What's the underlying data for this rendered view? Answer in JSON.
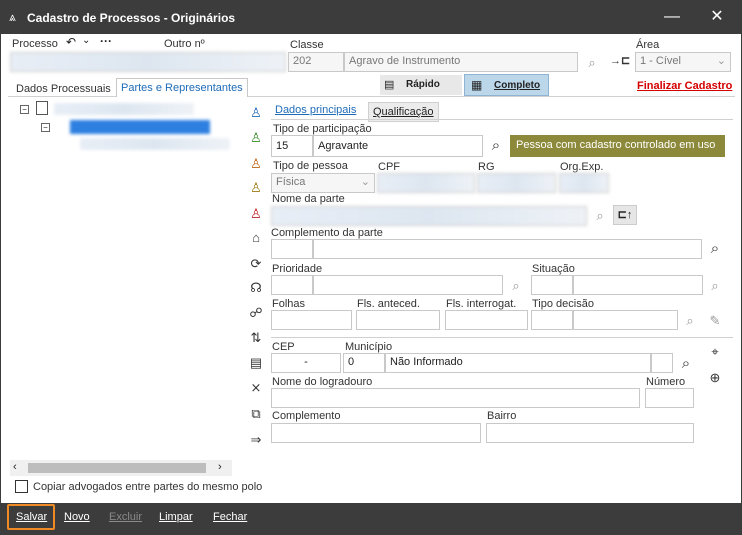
{
  "window": {
    "title": "Cadastro de Processos - Originários"
  },
  "header": {
    "processo_label": "Processo",
    "outro_label": "Outro nº",
    "classe_label": "Classe",
    "classe_code": "202",
    "classe_name": "Agravo de Instrumento",
    "area_label": "Área",
    "area_value": "1 - Cível"
  },
  "tabs": {
    "dados_processuais": "Dados Processuais",
    "partes": "Partes e Representantes",
    "rapido": "Rápido",
    "completo": "Completo",
    "finalizar": "Finalizar Cadastro"
  },
  "subtabs": {
    "principais": "Dados principais",
    "qualificacao": "Qualificação"
  },
  "form": {
    "tipo_participacao_label": "Tipo de participação",
    "tipo_participacao_code": "15",
    "tipo_participacao_value": "Agravante",
    "cadastro_controlado": "Pessoa com cadastro controlado em uso",
    "tipo_pessoa_label": "Tipo de pessoa",
    "tipo_pessoa_value": "Física",
    "cpf_label": "CPF",
    "rg_label": "RG",
    "org_exp_label": "Org.Exp.",
    "nome_parte_label": "Nome da parte",
    "complemento_parte_label": "Complemento da parte",
    "prioridade_label": "Prioridade",
    "situacao_label": "Situação",
    "folhas_label": "Folhas",
    "fls_anteced_label": "Fls. anteced.",
    "fls_interrogat_label": "Fls. interrogat.",
    "tipo_decisao_label": "Tipo decisão",
    "cep_label": "CEP",
    "cep_value": "-",
    "municipio_label": "Município",
    "municipio_code": "0",
    "municipio_value": "Não Informado",
    "logradouro_label": "Nome do logradouro",
    "numero_label": "Número",
    "complemento_label": "Complemento",
    "bairro_label": "Bairro"
  },
  "copiar_label": "Copiar advogados entre partes do mesmo polo",
  "footer": {
    "salvar": "Salvar",
    "novo": "Novo",
    "excluir": "Excluir",
    "limpar": "Limpar",
    "fechar": "Fechar"
  }
}
